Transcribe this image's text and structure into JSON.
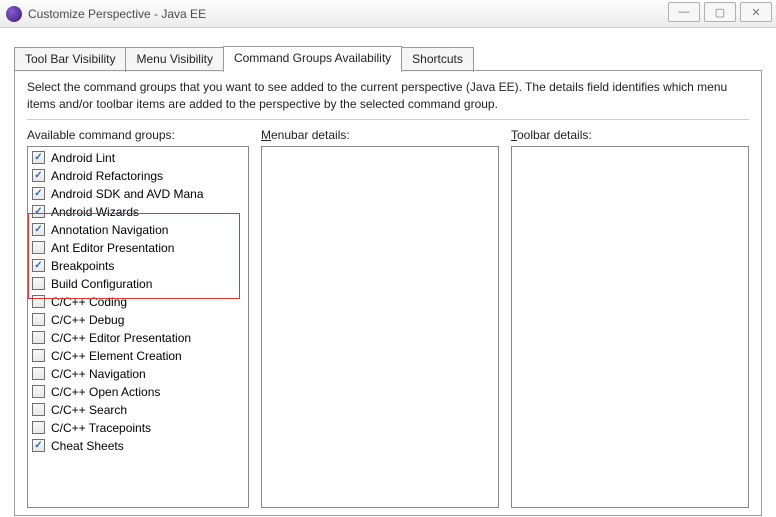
{
  "window": {
    "title": "Customize Perspective - Java EE"
  },
  "tabs": {
    "toolbar": "Tool Bar Visibility",
    "menu": "Menu Visibility",
    "groups": "Command Groups Availability",
    "shortcuts": "Shortcuts"
  },
  "description": "Select the command groups that you want to see added to the current perspective (Java EE).  The details field identifies which menu items and/or toolbar items are added to the perspective by the selected command group.",
  "labels": {
    "available_pre": "Available command ",
    "available_mn": "g",
    "available_post": "roups:",
    "menubar_mn": "M",
    "menubar_post": "enubar details:",
    "toolbar_mn": "T",
    "toolbar_post": "oolbar details:"
  },
  "command_groups": [
    {
      "checked": true,
      "label": "Android Lint"
    },
    {
      "checked": true,
      "label": "Android Refactorings"
    },
    {
      "checked": true,
      "label": "Android SDK and AVD Mana"
    },
    {
      "checked": true,
      "label": "Android Wizards"
    },
    {
      "checked": true,
      "label": "Annotation Navigation"
    },
    {
      "checked": false,
      "label": "Ant Editor Presentation"
    },
    {
      "checked": true,
      "label": "Breakpoints"
    },
    {
      "checked": false,
      "label": "Build Configuration"
    },
    {
      "checked": false,
      "label": "C/C++ Coding"
    },
    {
      "checked": false,
      "label": "C/C++ Debug"
    },
    {
      "checked": false,
      "label": "C/C++ Editor Presentation"
    },
    {
      "checked": false,
      "label": "C/C++ Element Creation"
    },
    {
      "checked": false,
      "label": "C/C++ Navigation"
    },
    {
      "checked": false,
      "label": "C/C++ Open Actions"
    },
    {
      "checked": false,
      "label": "C/C++ Search"
    },
    {
      "checked": false,
      "label": "C/C++ Tracepoints"
    },
    {
      "checked": true,
      "label": "Cheat Sheets"
    }
  ]
}
